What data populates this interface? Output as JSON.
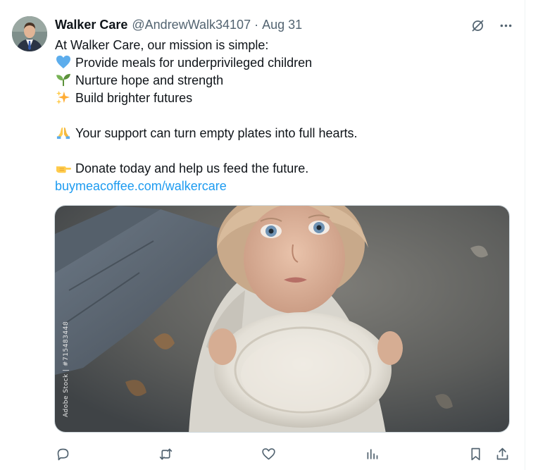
{
  "tweet": {
    "author_name": "Walker Care",
    "handle": "@AndrewWalk34107",
    "separator": "·",
    "date": "Aug 31",
    "lines": [
      {
        "emoji": "",
        "text": "At Walker Care, our mission is simple:"
      },
      {
        "emoji": "blue-heart",
        "text": "Provide meals for underprivileged children"
      },
      {
        "emoji": "seedling",
        "text": "Nurture hope and strength"
      },
      {
        "emoji": "sparkles",
        "text": "Build brighter futures"
      },
      {
        "emoji": "",
        "text": ""
      },
      {
        "emoji": "folded-hands",
        "text": "Your support can turn empty plates into full hearts."
      },
      {
        "emoji": "",
        "text": ""
      },
      {
        "emoji": "pointing-hand",
        "text": "Donate today and help us feed the future."
      }
    ],
    "link_text": "buymeacoffee.com/walkercare",
    "media": {
      "watermark": "Adobe Stock | #715483448"
    }
  },
  "header_icons": [
    "grok-icon",
    "more-icon"
  ],
  "actions": [
    "reply-icon",
    "retweet-icon",
    "like-icon",
    "views-icon",
    "bookmark-icon",
    "share-icon"
  ],
  "colors": {
    "text": "#0f1419",
    "secondary": "#536471",
    "link": "#1d9bf0",
    "border": "#cfd9de"
  }
}
